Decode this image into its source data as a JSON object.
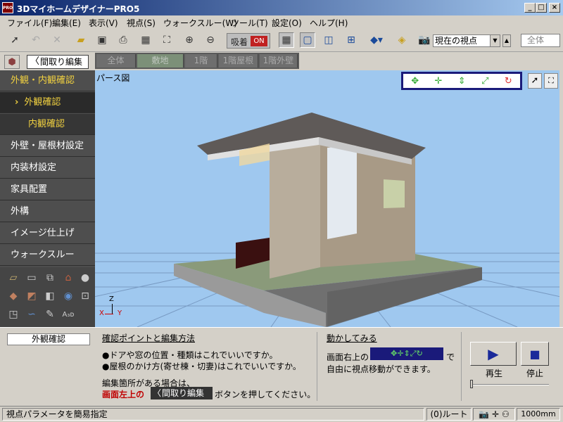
{
  "window": {
    "title": "3DマイホームデザイナーPRO5",
    "app_icon": "PRO",
    "min": "_",
    "max": "□",
    "close": "×"
  },
  "menu": [
    "ファイル(F)",
    "編集(E)",
    "表示(V)",
    "視点(S)",
    "ウォークスルー(W)",
    "ツール(T)",
    "設定(O)",
    "ヘルプ(H)"
  ],
  "toolbar": {
    "snap_label": "吸着",
    "snap_state": "ON",
    "view_select": "現在の視点",
    "all_box": "全体"
  },
  "modebar": {
    "madori_button": "間取り編集",
    "floor_tabs": [
      "全体",
      "敷地",
      "1階",
      "1階屋根",
      "1階外壁"
    ]
  },
  "sidebar": {
    "items": [
      "外観・内観確認",
      "外観確認",
      "内観確認",
      "外壁・屋根材設定",
      "内装材設定",
      "家具配置",
      "外構",
      "イメージ仕上げ",
      "ウォークスルー"
    ]
  },
  "viewport": {
    "label": "パース図",
    "axis_z": "Z",
    "axis_x": "X",
    "axis_y": "Y"
  },
  "bottom": {
    "mode_name": "外観確認",
    "check_head": "確認ポイントと編集方法",
    "check_1": "●ドアや窓の位置・種類はこれでいいですか。",
    "check_2": "●屋根のかけ方(寄せ棟・切妻)はこれでいいですか。",
    "note_1": "編集箇所がある場合は、",
    "note_2": "画面左上の",
    "note_btn": "間取り編集",
    "note_3": "ボタンを押してください。",
    "try_head": "動かしてみる",
    "try_1a": "画面右上の",
    "try_1b": "で",
    "try_2": "自由に視点移動ができます。",
    "play": "再生",
    "stop": "停止",
    "playback_progress": 0.0
  },
  "status": {
    "message": "視点パラメータを簡易指定",
    "route": "(0)ルート",
    "scale": "1000mm"
  }
}
